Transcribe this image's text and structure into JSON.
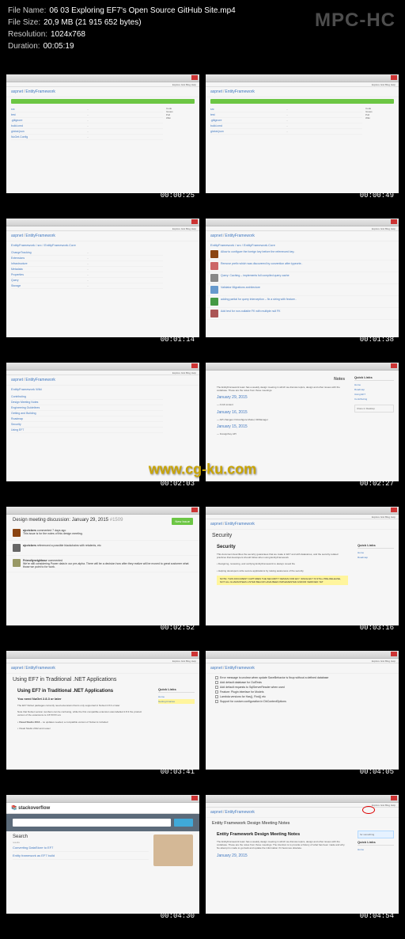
{
  "header": {
    "file_name_label": "File Name:",
    "file_name": "06 03 Exploring EF7's Open Source GitHub Site.mp4",
    "file_size_label": "File Size:",
    "file_size": "20,9 MB (21 915 652 bytes)",
    "resolution_label": "Resolution:",
    "resolution": "1024x768",
    "duration_label": "Duration:",
    "duration": "00:05:19",
    "player": "MPC-HC"
  },
  "watermark": "www.cg-ku.com",
  "github": {
    "nav_items": "Explore  Gist  Blog  Help",
    "repo_owner": "aspnet",
    "repo_name": "EntityFramework",
    "repo_sub_core": "EntityFramework.Core",
    "wiki_suffix": "Wiki"
  },
  "thumbs": [
    {
      "ts": "00:00:25"
    },
    {
      "ts": "00:00:49"
    },
    {
      "ts": "00:01:14"
    },
    {
      "ts": "00:01:38"
    },
    {
      "ts": "00:02:03"
    },
    {
      "ts": "00:02:27"
    },
    {
      "ts": "00:02:52"
    },
    {
      "ts": "00:03:16"
    },
    {
      "ts": "00:03:41"
    },
    {
      "ts": "00:04:05"
    },
    {
      "ts": "00:04:30"
    },
    {
      "ts": "00:04:54"
    }
  ],
  "notes_page": {
    "quick_links": "Quick Links",
    "dates": [
      "January 29, 2015",
      "January 16, 2015",
      "January 15, 2015"
    ],
    "notes_title": "Notes"
  },
  "issue_page": {
    "title": "Design meeting discussion: January 29, 2015",
    "number": "#1509",
    "new_label": "New Issue"
  },
  "security_page": {
    "title": "Security",
    "subtitle": "Security",
    "bullets": [
      "Designing, reviewing, and verifying EntityFramework to always reveal the",
      "Helping developers write secure applications by raising awareness of the security"
    ]
  },
  "ef7_page": {
    "title": "Using EF7 in Traditional .NET Applications",
    "subtitle": "Using EF7 in Traditional .NET Applications",
    "need": "You need NuGet 2.8.3 or later",
    "vs_item": "Visual Studio 2013"
  },
  "issues_list": {
    "items": [
      "Error message is unclear when update SaveBehavior is fixup without a defined database",
      "Add default database for OutTests",
      "Add default requests to SqlServerReader when used",
      "Feature: Plugin interface for Models",
      "Lambda versions for Has(), Find() etc",
      "Support for custom configuration in DbContextOptions"
    ]
  },
  "so_page": {
    "logo": "stackoverflow",
    "search_title": "Search",
    "results_label": "results",
    "questions": [
      "Converting DataStore to EF7",
      "Entity framework as EF7 build"
    ]
  },
  "wiki_notes": {
    "title": "Entity Framework Design Meeting Notes",
    "subtitle": "Entity Framework Design Meeting Notes",
    "date": "January 29, 2015",
    "side_label": "for something"
  }
}
